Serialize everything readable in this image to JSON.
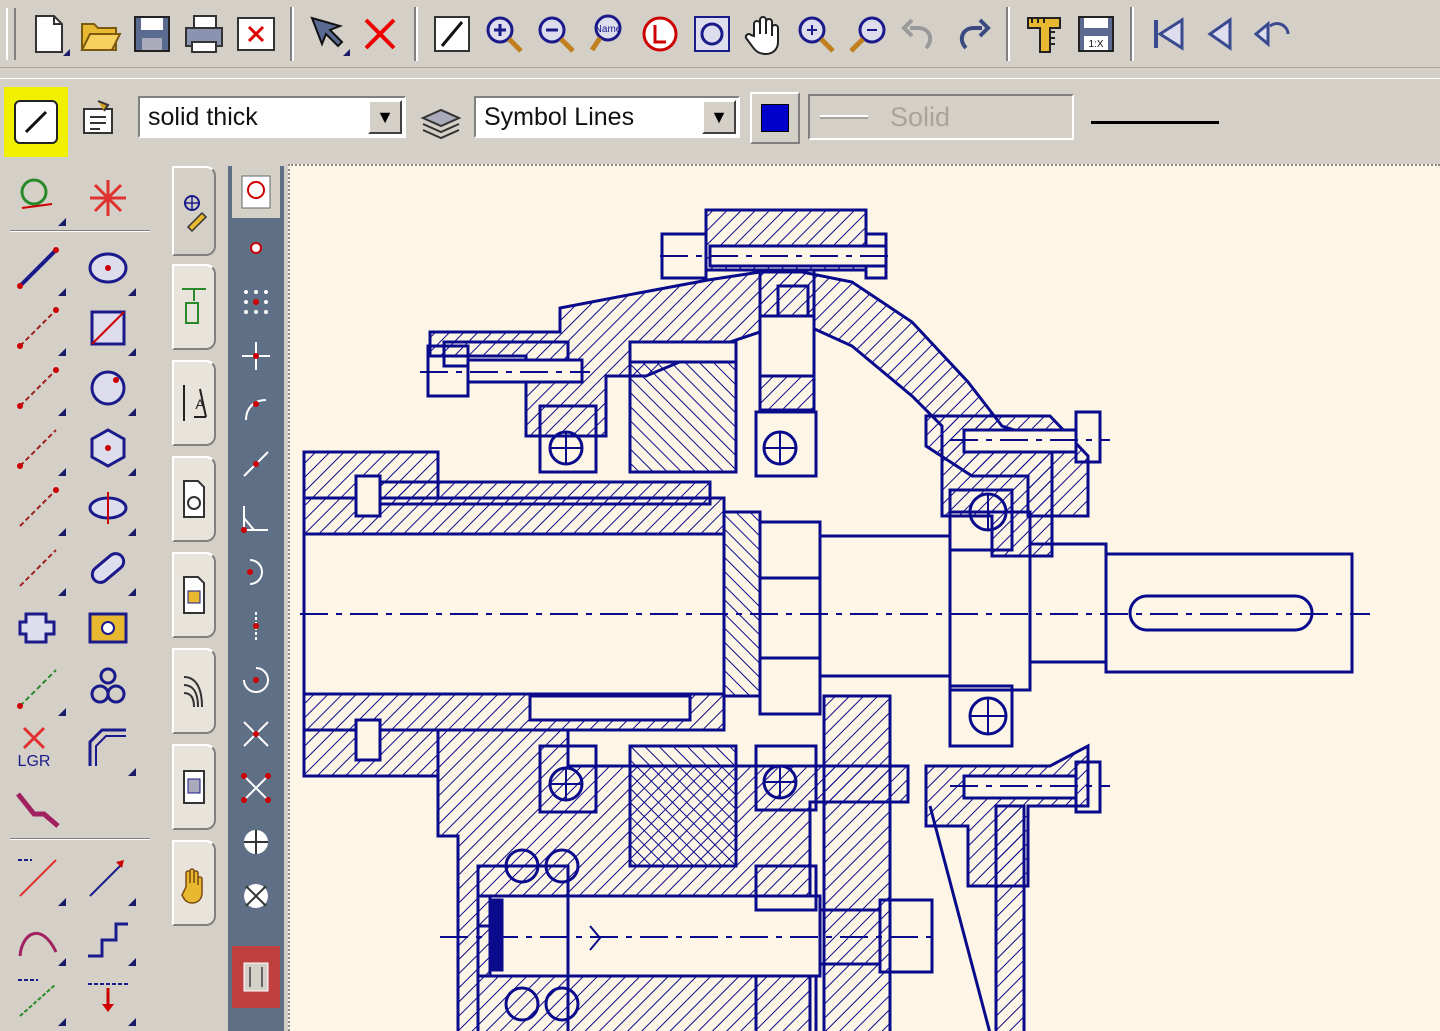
{
  "toolbar_main": {
    "buttons": [
      "new-document-icon",
      "open-folder-icon",
      "save-icon",
      "print-icon",
      "close-document-icon",
      "select-arrow-icon",
      "delete-icon",
      "draw-line-icon",
      "zoom-in-icon",
      "zoom-out-icon",
      "zoom-name-icon",
      "layers-icon",
      "zoom-window-icon",
      "pan-hand-icon",
      "zoom-plus-icon",
      "zoom-minus-icon",
      "undo-icon",
      "redo-icon",
      "measure-icon",
      "scale-save-icon",
      "first-page-icon",
      "previous-page-icon",
      "next-page-icon"
    ],
    "zoom_name_label": "Name",
    "scale_label": "1:X"
  },
  "properties_bar": {
    "pen_style_value": "solid thick",
    "layer_value": "Symbol Lines",
    "color": "#0000cc",
    "line_type_value": "Solid"
  },
  "palette": {
    "label_lgr": "LGR"
  },
  "drawing": {
    "line_color": "#0a0a8c",
    "background": "#fdf6e6"
  }
}
